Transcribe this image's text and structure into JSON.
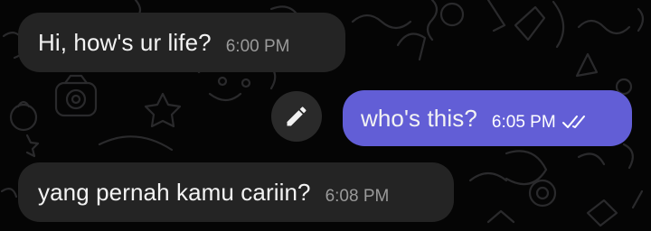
{
  "messages": [
    {
      "direction": "incoming",
      "text": "Hi, how's ur life?",
      "time": "6:00 PM"
    },
    {
      "direction": "outgoing",
      "text": "who's this?",
      "time": "6:05 PM",
      "status": "read-checkmarks"
    },
    {
      "direction": "incoming",
      "text": "yang pernah kamu cariin?",
      "time": "6:08 PM"
    }
  ],
  "actions": {
    "edit_icon": "pencil-icon"
  },
  "colors": {
    "background": "#050505",
    "incoming_bubble": "#242424",
    "outgoing_bubble": "#625ed6",
    "timestamp_incoming": "#9a9a9a"
  }
}
